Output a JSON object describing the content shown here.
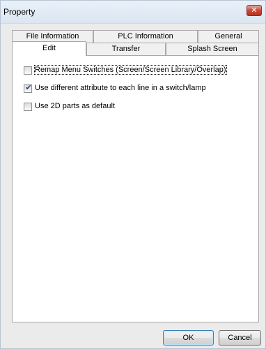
{
  "window": {
    "title": "Property",
    "close_label": "✕"
  },
  "tabs": {
    "row1": [
      "File Information",
      "PLC Information",
      "General"
    ],
    "row2": [
      "Edit",
      "Transfer",
      "Splash Screen"
    ],
    "selected": "Edit"
  },
  "options": [
    {
      "label": "Remap Menu Switches (Screen/Screen Library/Overlap)",
      "checked": false,
      "focused": true
    },
    {
      "label": "Use different attribute to each line in a switch/lamp",
      "checked": true,
      "focused": false
    },
    {
      "label": "Use 2D parts as default",
      "checked": false,
      "focused": false
    }
  ],
  "buttons": {
    "ok": "OK",
    "cancel": "Cancel"
  },
  "colors": {
    "check_mark": "#1f3d7a",
    "close_button": "#c8483a"
  },
  "icons": {
    "check": "check-mark-icon",
    "close": "close-icon"
  }
}
